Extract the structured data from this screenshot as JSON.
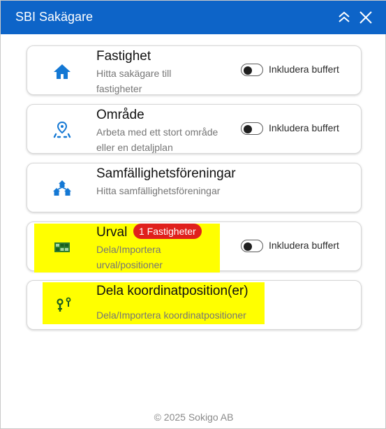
{
  "header": {
    "title": "SBI Sakägare",
    "background": "#0d64c8",
    "collapse_icon": "double-chevron-up-icon",
    "close_icon": "close-icon"
  },
  "cards": [
    {
      "title": "Fastighet",
      "description": "Hitta sakägare till fastigheter",
      "icon": "house-icon",
      "toggle_label": "Inkludera buffert",
      "toggle_on": false
    },
    {
      "title": "Område",
      "description": "Arbeta med ett stort område eller en detaljplan",
      "icon": "area-pin-icon",
      "toggle_label": "Inkludera buffert",
      "toggle_on": false
    },
    {
      "title": "Samfällighetsföreningar",
      "description": "Hitta samfällighetsföreningar",
      "icon": "association-houses-icon"
    },
    {
      "title": "Urval",
      "badge": "1 Fastigheter",
      "badge_color": "#e0201c",
      "description": "Dela/Importera urval/positioner",
      "icon": "selection-grid-icon",
      "toggle_label": "Inkludera buffert",
      "toggle_on": false,
      "highlighted": true
    },
    {
      "title": "Dela koordinatposition(er)",
      "description": "Dela/Importera koordinatpositioner",
      "icon": "coordinate-markers-icon",
      "highlighted": true
    }
  ],
  "highlight_color": "#ffff00",
  "footer": {
    "copyright": "© 2025 Sokigo AB"
  }
}
